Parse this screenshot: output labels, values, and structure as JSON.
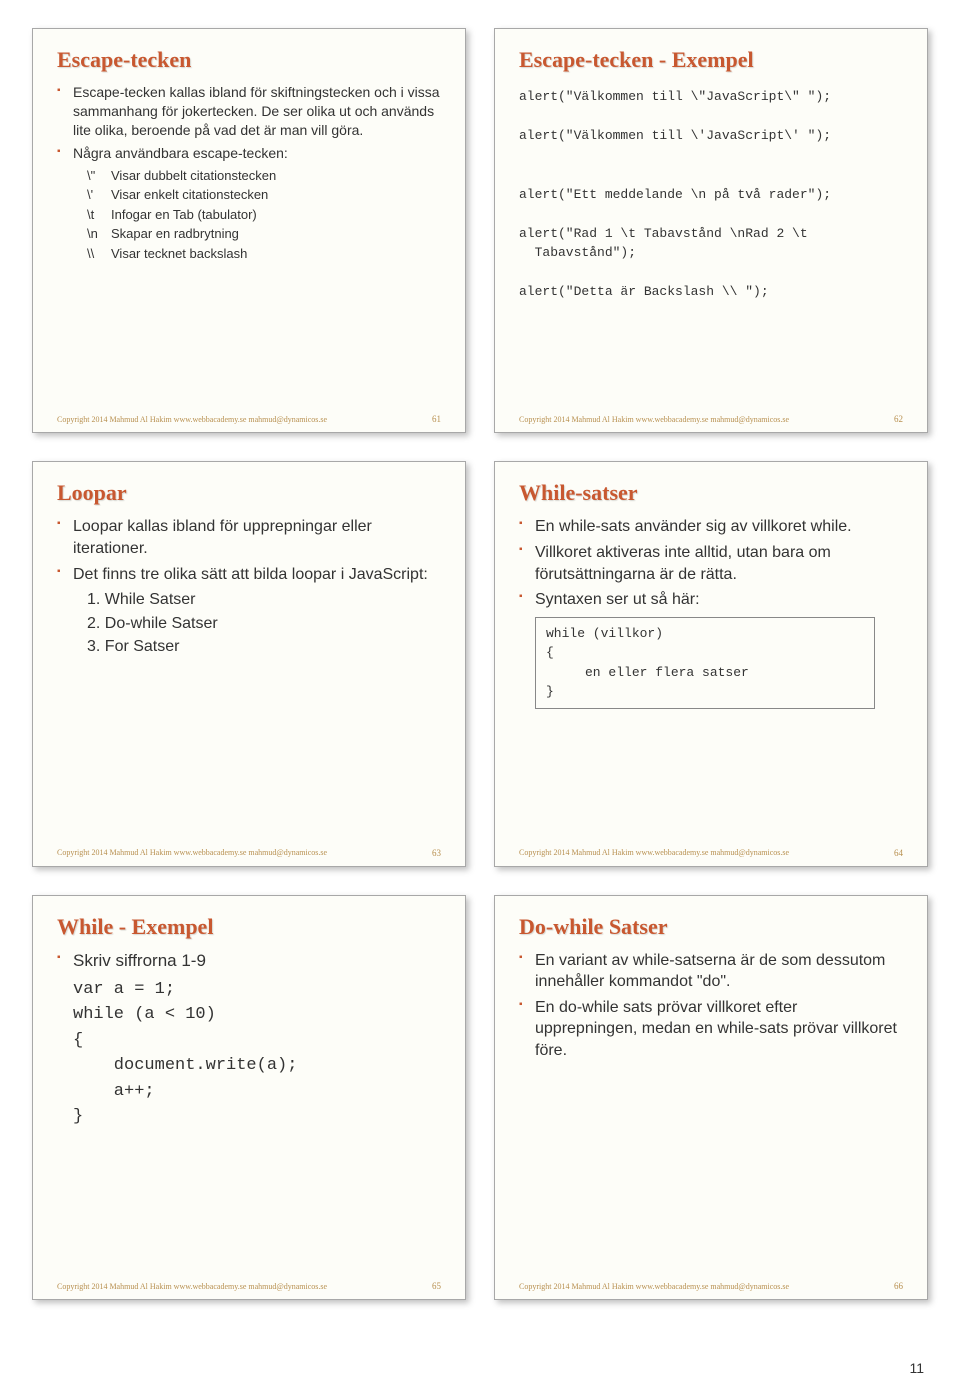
{
  "pagenum": "11",
  "slides": {
    "s1": {
      "title": "Escape-tecken",
      "b1": "Escape-tecken kallas ibland för skiftningstecken och i vissa sammanhang för jokertecken. De ser olika ut och används lite olika, beroende på vad det är man vill göra.",
      "b2": "Några användbara escape-tecken:",
      "e1a": "\\\"",
      "e1b": "Visar dubbelt citationstecken",
      "e2a": "\\'",
      "e2b": "Visar enkelt citationstecken",
      "e3a": "\\t",
      "e3b": "Infogar en Tab (tabulator)",
      "e4a": "\\n",
      "e4b": "Skapar en radbrytning",
      "e5a": "\\\\",
      "e5b": "Visar tecknet backslash",
      "pg": "61"
    },
    "s2": {
      "title": "Escape-tecken - Exempel",
      "code": "alert(\"Välkommen till \\\"JavaScript\\\" \");\n\nalert(\"Välkommen till \\'JavaScript\\' \");\n\n\nalert(\"Ett meddelande \\n på två rader\");\n\nalert(\"Rad 1 \\t Tabavstånd \\nRad 2 \\t\n  Tabavstånd\");\n\nalert(\"Detta är Backslash \\\\ \");",
      "pg": "62"
    },
    "s3": {
      "title": "Loopar",
      "b1": "Loopar kallas ibland för upprepningar eller iterationer.",
      "b2": "Det finns tre olika sätt att bilda loopar i JavaScript:",
      "n1": "1.  While Satser",
      "n2": "2.  Do-while Satser",
      "n3": "3.  For Satser",
      "pg": "63"
    },
    "s4": {
      "title": "While-satser",
      "b1": "En while-sats använder sig av villkoret while.",
      "b2": "Villkoret aktiveras inte alltid, utan bara om förutsättningarna är de rätta.",
      "b3": "Syntaxen ser ut så här:",
      "code": "while (villkor)\n{\n     en eller flera satser\n}",
      "pg": "64"
    },
    "s5": {
      "title": "While - Exempel",
      "b1": "Skriv siffrorna 1-9",
      "code": "var a = 1;\nwhile (a < 10)\n{\n    document.write(a);\n    a++;\n}",
      "pg": "65"
    },
    "s6": {
      "title": "Do-while Satser",
      "b1": "En variant av while-satserna är de som dessutom innehåller kommandot \"do\".",
      "b2": "En do-while sats prövar villkoret efter upprepningen, medan en while-sats prövar villkoret före.",
      "pg": "66"
    }
  },
  "copyright": "Copyright 2014 Mahmud Al Hakim  www.webbacademy.se  mahmud@dynamicos.se"
}
